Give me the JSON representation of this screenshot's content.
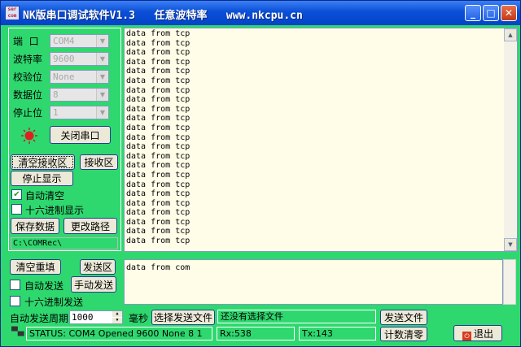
{
  "window": {
    "title": "NK版串口调试软件V1.3   任意波特率   www.nkcpu.cn",
    "app_icon_text": "ser com",
    "minimize_glyph": "_",
    "maximize_glyph": "□",
    "close_glyph": "✕"
  },
  "settings": {
    "port_label": "端  口",
    "port_value": "COM4",
    "baud_label": "波特率",
    "baud_value": "9600",
    "parity_label": "校验位",
    "parity_value": "None",
    "databits_label": "数据位",
    "databits_value": "8",
    "stopbits_label": "停止位",
    "stopbits_value": "1",
    "close_port_label": "关闭串口",
    "status_led_color": "#e02020"
  },
  "receive": {
    "clear_label": "清空接收区",
    "rx_area_label": "接收区",
    "stop_display_label": "停止显示",
    "auto_clear_label": "自动清空",
    "auto_clear_checked": true,
    "hex_display_label": "十六进制显示",
    "hex_display_checked": false,
    "save_data_label": "保存数据",
    "change_path_label": "更改路径",
    "save_path": "C:\\COMRec\\",
    "lines": [
      "data from tcp",
      "data from tcp",
      "data from tcp",
      "data from tcp",
      "data from tcp",
      "data from tcp",
      "data from tcp",
      "data from tcp",
      "data from tcp",
      "data from tcp",
      "data from tcp",
      "data from tcp",
      "data from tcp",
      "data from tcp",
      "data from tcp",
      "data from tcp",
      "data from tcp",
      "data from tcp",
      "data from tcp",
      "data from tcp",
      "data from tcp",
      "data from tcp",
      "data from tcp"
    ]
  },
  "send": {
    "clear_resend_label": "清空重填",
    "tx_area_label": "发送区",
    "auto_send_label": "自动发送",
    "auto_send_checked": false,
    "manual_send_label": "手动发送",
    "hex_send_label": "十六进制发送",
    "hex_send_checked": false,
    "text": "data from com",
    "period_label": "自动发送周期",
    "period_value": "1000",
    "ms_label": "毫秒",
    "choose_file_label": "选择发送文件",
    "file_status": "还没有选择文件",
    "send_file_label": "发送文件",
    "clear_count_label": "计数清零",
    "exit_label": "退出"
  },
  "statusbar": {
    "status": "STATUS: COM4 Opened 9600 None 8 1",
    "rx": "Rx:538",
    "tx": "Tx:143"
  },
  "colors": {
    "window_bg": "#2fd86f",
    "text_area_bg": "#fffde8",
    "button_face": "#ece9d8",
    "titlebar": "#0a4fd6"
  }
}
